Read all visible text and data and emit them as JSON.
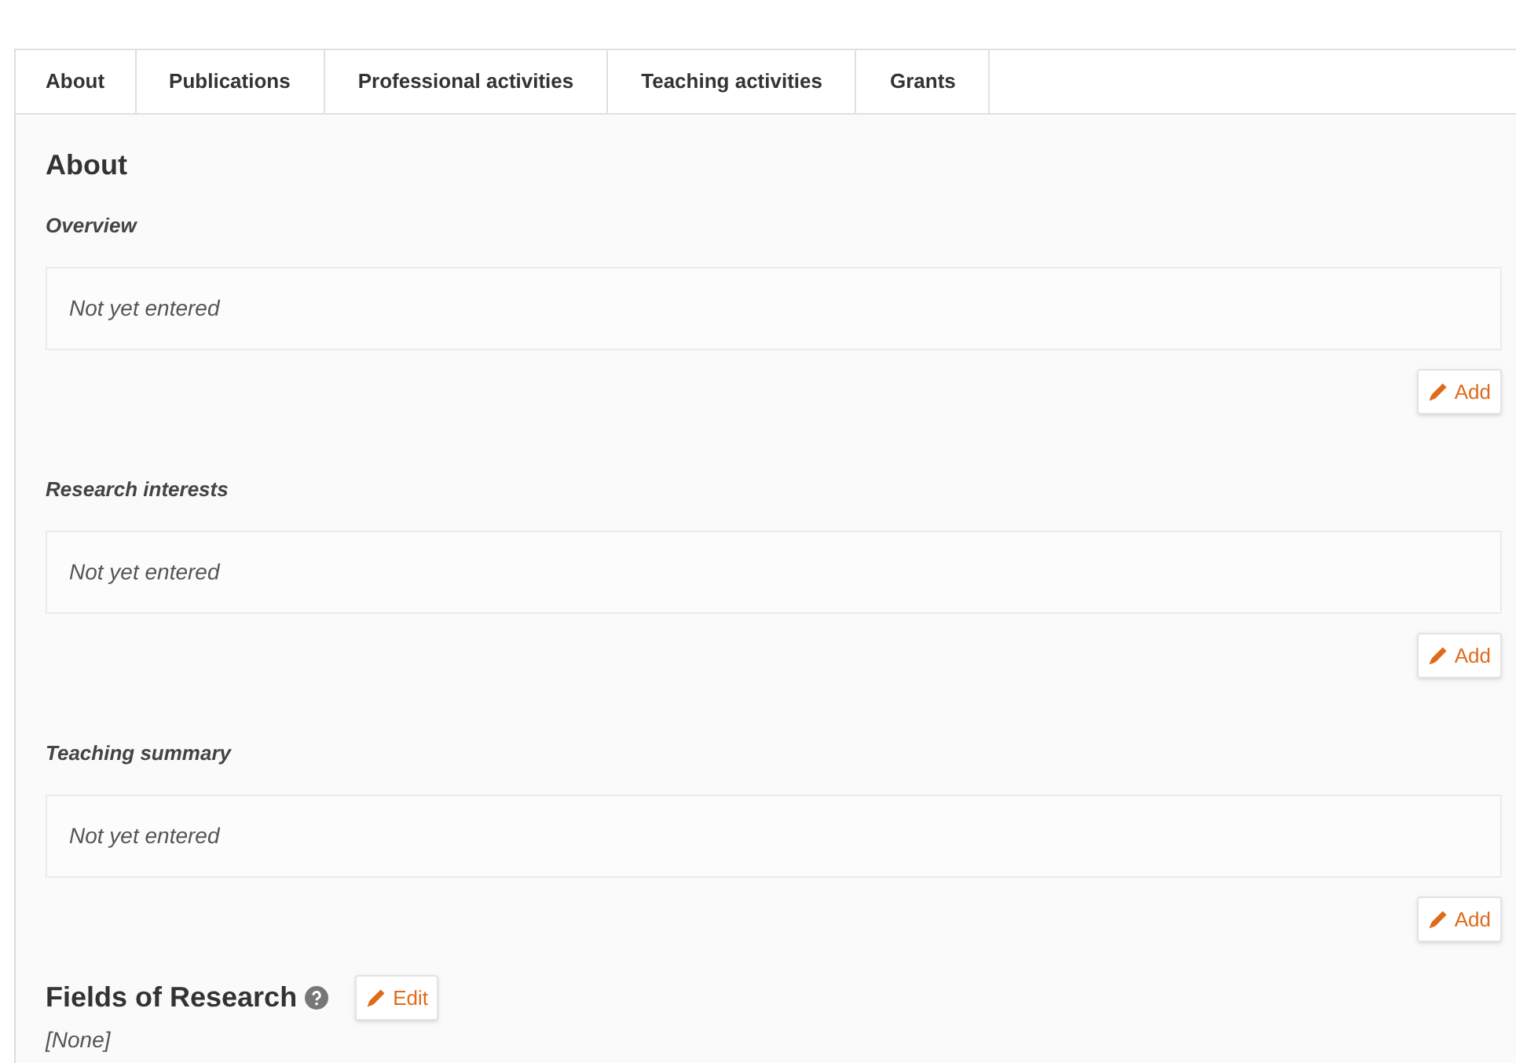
{
  "tabs": [
    {
      "label": "About"
    },
    {
      "label": "Publications"
    },
    {
      "label": "Professional activities"
    },
    {
      "label": "Teaching activities"
    },
    {
      "label": "Grants"
    }
  ],
  "heading": "About",
  "sections": [
    {
      "label": "Overview",
      "value": "Not yet entered",
      "button": "Add"
    },
    {
      "label": "Research interests",
      "value": "Not yet entered",
      "button": "Add"
    },
    {
      "label": "Teaching summary",
      "value": "Not yet entered",
      "button": "Add"
    }
  ],
  "fields_of_research": {
    "title": "Fields of Research",
    "button": "Edit",
    "value": "[None]"
  }
}
